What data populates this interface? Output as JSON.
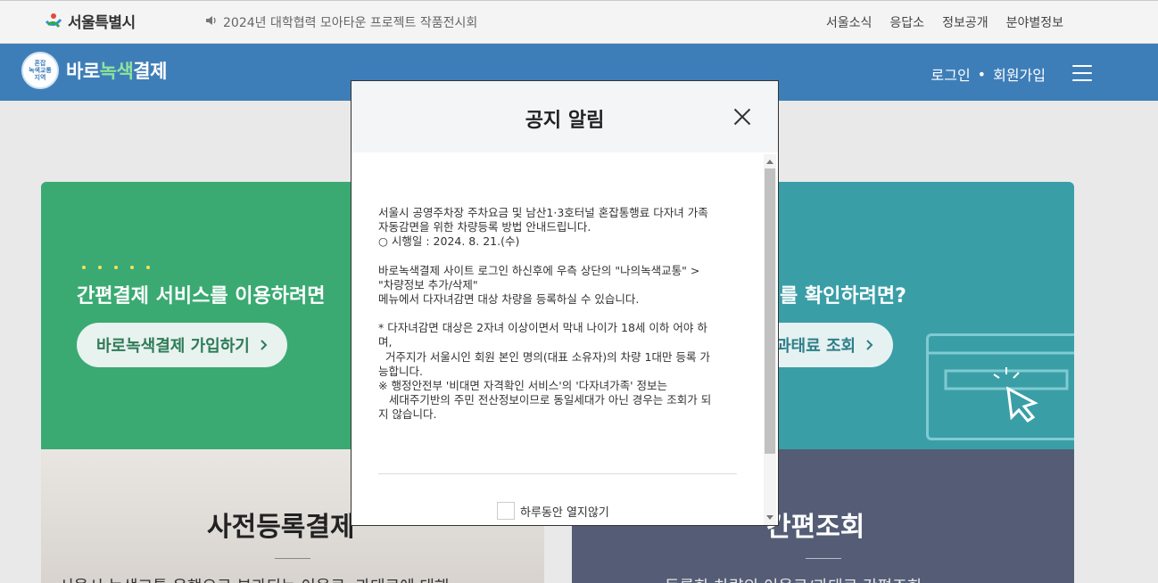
{
  "topbar": {
    "logo_text": "서울특별시",
    "notice": "2024년 대학협력 모아타운 프로젝트 작품전시회",
    "links": [
      "서울소식",
      "응답소",
      "정보공개",
      "분야별정보"
    ]
  },
  "nav": {
    "emblem_lines": [
      "혼잡",
      "녹색교통",
      "지역"
    ],
    "brand_prefix": "바로",
    "brand_green": "녹색",
    "brand_suffix": "결제",
    "login": "로그인",
    "separator": "•",
    "signup": "회원가입"
  },
  "cards": {
    "left_heading": "간편결제 서비스를 이용하려면",
    "left_button": "바로녹색결제 가입하기",
    "right_heading": "를 확인하려면?",
    "right_button": "과태료 조회",
    "photo_title": "사전등록결제",
    "photo_desc": "서울시 녹색교통 운행으로 부과되는 이용료, 과태료에 대해",
    "dark_title": "간편조회",
    "dark_desc": "등록한 차량의 이용료/과태료 간편조회"
  },
  "modal": {
    "title": "공지 알림",
    "paragraphs": [
      [
        "서울시 공영주차장 주차요금 및 남산1·3호터널 혼잡통행료 다자녀 가족 자동감면을 위한 차량등록 방법 안내드립니다.",
        "○ 시행일 : 2024. 8. 21.(수)"
      ],
      [
        "바로녹색결제 사이트 로그인 하신후에 우측 상단의 \"나의녹색교통\" > \"차량정보 추가/삭제\"",
        "메뉴에서 다자녀감면 대상 차량을 등록하실 수 있습니다."
      ],
      [
        "* 다자녀감면 대상은 2자녀 이상이면서 막내 나이가 18세 이하 어야 하며,",
        "  거주지가 서울시인 회원 본인 명의(대표 소유자)의 차량 1대만 등록 가능합니다.",
        "※ 행정안전부 '비대면 자격확인 서비스'의 '다자녀가족' 정보는",
        "   세대주기반의 주민 전산정보이므로 동일세대가 아닌 경우는 조회가 되지 않습니다."
      ]
    ],
    "no_show_today": "하루동안 열지않기"
  },
  "colors": {
    "nav_blue": "#3e7eb8",
    "card_green": "#3aaa72",
    "card_teal": "#3a9ea7",
    "card_dark": "#545d75"
  }
}
